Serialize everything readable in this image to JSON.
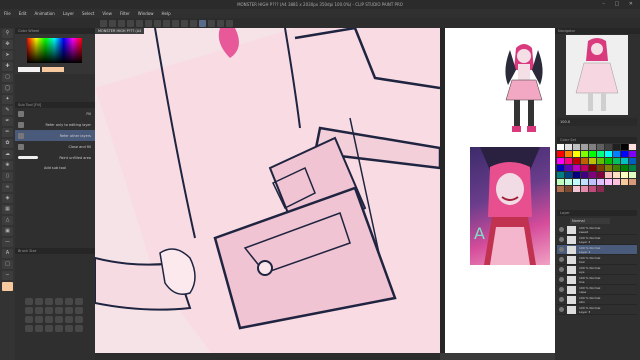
{
  "app": {
    "title": "MONSTER HIGH P??? (A4 3881 x 2030px 350dpi 100.0%) - CLIP STUDIO PAINT PRO"
  },
  "menu": [
    "File",
    "Edit",
    "Animation",
    "Layer",
    "Select",
    "View",
    "Filter",
    "Window",
    "Help"
  ],
  "canvas": {
    "tab_label": "MONSTER HIGH P??? (A4"
  },
  "left": {
    "color_tab": "Color Wheel",
    "subtool_tab": "Sub Tool [Fill]",
    "subtools": [
      {
        "label": "Fill"
      },
      {
        "label": "Refer only to editing layer"
      },
      {
        "label": "Refer other layers"
      },
      {
        "label": "Close and fill"
      },
      {
        "label": "Paint unfilled area"
      }
    ],
    "add_subtool": "Add sub tool",
    "brush_tab": "Brush Size"
  },
  "right": {
    "navigator_tab": "Navigator",
    "zoom": "100.0",
    "color_set_tab": "Color Set",
    "layer_tab": "Layer",
    "blend_mode": "Normal",
    "layers": [
      {
        "opacity": "100 % Normal",
        "name": "sweat"
      },
      {
        "opacity": "100 % Normal",
        "name": "Layer 2"
      },
      {
        "opacity": "100 % Normal",
        "name": "Layer 4"
      },
      {
        "opacity": "100 % Normal",
        "name": "hair"
      },
      {
        "opacity": "100 % Normal",
        "name": "eye"
      },
      {
        "opacity": "100 % Normal",
        "name": "line"
      },
      {
        "opacity": "100 % Normal",
        "name": "cape"
      },
      {
        "opacity": "100 % Normal",
        "name": "skin"
      },
      {
        "opacity": "100 % Normal",
        "name": "Layer 3"
      }
    ]
  },
  "colors": {
    "accent": "#4a5a7a",
    "canvas_bg": "#f6e3e8",
    "primary_swatch": "#f4f2f3",
    "secondary_swatch": "#f6c99f",
    "palette": [
      "#ffffff",
      "#e0e0e0",
      "#c0c0c0",
      "#a0a0a0",
      "#808080",
      "#606060",
      "#404040",
      "#202020",
      "#000000",
      "#ffe0e0",
      "#ff0000",
      "#ff8000",
      "#ffff00",
      "#80ff00",
      "#00ff00",
      "#00ff80",
      "#00ffff",
      "#0080ff",
      "#0000ff",
      "#8000ff",
      "#ff00ff",
      "#ff0080",
      "#c00000",
      "#c06000",
      "#c0c000",
      "#60c000",
      "#00c000",
      "#00c060",
      "#00c0c0",
      "#0060c0",
      "#0000c0",
      "#6000c0",
      "#c000c0",
      "#c00060",
      "#800000",
      "#804000",
      "#808000",
      "#408000",
      "#008000",
      "#008040",
      "#008080",
      "#004080",
      "#000080",
      "#400080",
      "#800080",
      "#800040",
      "#ffc0c0",
      "#ffe0c0",
      "#ffffc0",
      "#e0ffc0",
      "#c0ffc0",
      "#c0ffe0",
      "#c0ffff",
      "#c0e0ff",
      "#c0c0ff",
      "#e0c0ff",
      "#ffc0ff",
      "#ffc0e0",
      "#f6c99f",
      "#d89a78",
      "#b07050",
      "#7a4a30",
      "#f2c6d4",
      "#e48aab",
      "#c04a7a",
      "#8a2a52"
    ]
  }
}
